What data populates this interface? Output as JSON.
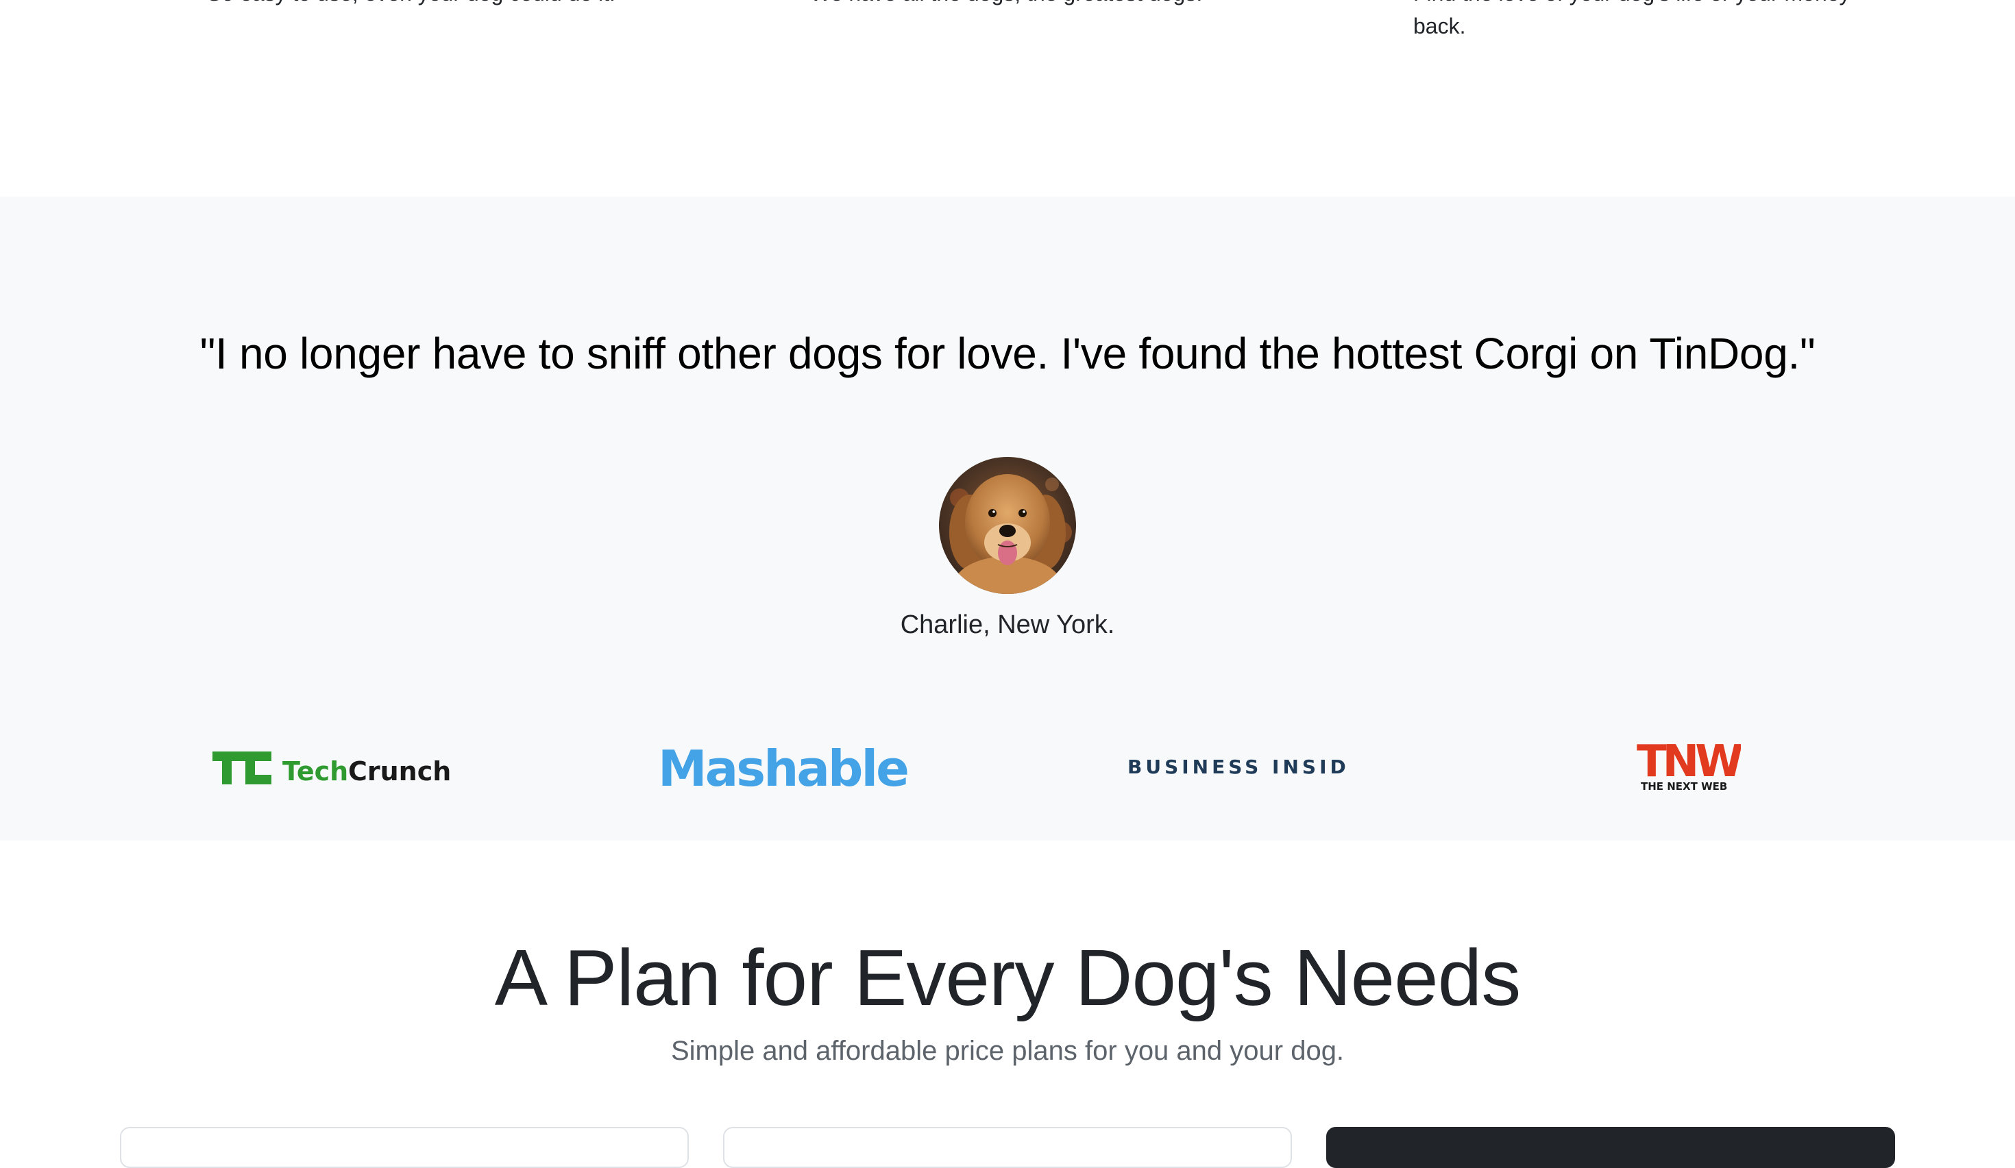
{
  "features": [
    {
      "text": "So easy to use, even your dog could do it."
    },
    {
      "text": "We have all the dogs, the greatest dogs."
    },
    {
      "text": "Find the love of your dog's life or your money back."
    }
  ],
  "testimonial": {
    "quote": "\"I no longer have to sniff other dogs for love. I've found the hottest Corgi on TinDog.\"",
    "attribution": "Charlie, New York.",
    "avatar_icon": "golden-retriever-photo"
  },
  "press": [
    {
      "name": "TechCrunch",
      "logo_text": "TechCrunch",
      "mark": "TC",
      "colors": {
        "mark": "#2e9a2f",
        "text": "#1a1a1a"
      }
    },
    {
      "name": "Mashable",
      "logo_text": "Mashable",
      "colors": {
        "text": "#44a3e6"
      }
    },
    {
      "name": "Business Insider",
      "logo_text": "BUSINESS INSIDER",
      "colors": {
        "text": "#1f3b57"
      }
    },
    {
      "name": "The Next Web",
      "logo_text": "TNW",
      "tagline": "THE NEXT WEB",
      "colors": {
        "mark": "#e13a1f",
        "text": "#1a1a1a"
      }
    }
  ],
  "pricing": {
    "title": "A Plan for Every Dog's Needs",
    "subtitle": "Simple and affordable price plans for you and your dog.",
    "cards": [
      {
        "style": "outline"
      },
      {
        "style": "outline"
      },
      {
        "style": "dark"
      }
    ]
  },
  "colors": {
    "section_bg": "#f8f9fa",
    "page_bg": "#ffffff",
    "text": "#212529",
    "muted": "#5c636a",
    "dark_card": "#212529"
  }
}
